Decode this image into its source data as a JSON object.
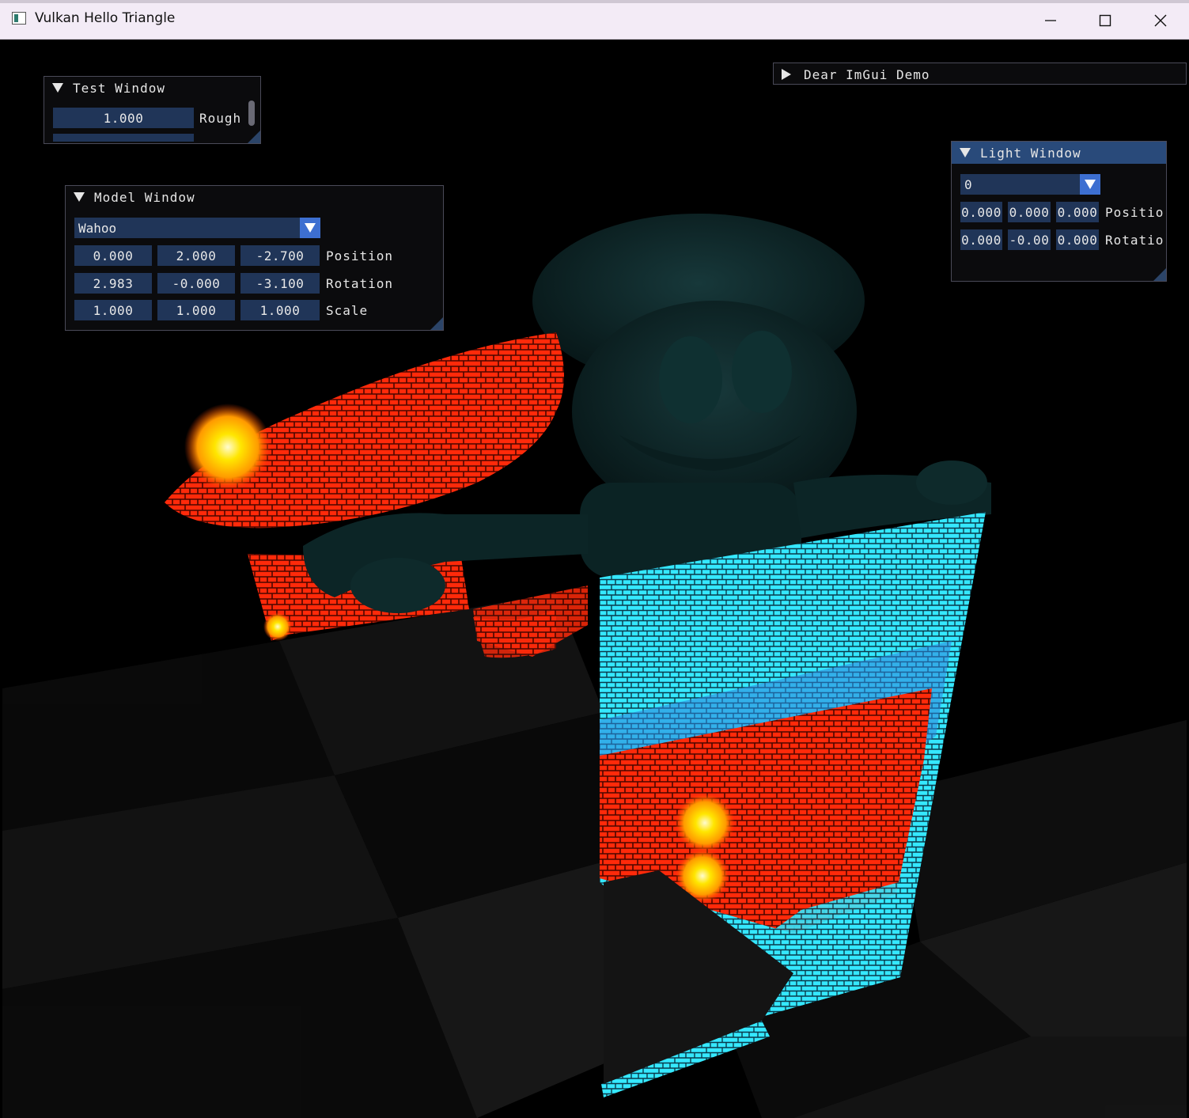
{
  "window": {
    "title": "Vulkan Hello Triangle",
    "controls": {
      "minimize": "─",
      "maximize": "☐",
      "close": "✕"
    }
  },
  "test_window": {
    "title": "Test Window",
    "rows": [
      {
        "value": "1.000",
        "label": "Rough"
      }
    ]
  },
  "demo_window": {
    "title": "Dear ImGui Demo"
  },
  "model_window": {
    "title": "Model Window",
    "selected_model": "Wahoo",
    "rows": [
      {
        "label": "Position",
        "values": [
          "0.000",
          "2.000",
          "-2.700"
        ]
      },
      {
        "label": "Rotation",
        "values": [
          "2.983",
          "-0.000",
          "-3.100"
        ]
      },
      {
        "label": "Scale",
        "values": [
          "1.000",
          "1.000",
          "1.000"
        ]
      }
    ]
  },
  "light_window": {
    "title": "Light Window",
    "selected_light": "0",
    "rows": [
      {
        "label": "Positio",
        "values": [
          "0.000",
          "0.000",
          "0.000"
        ]
      },
      {
        "label": "Rotatio",
        "values": [
          "0.000",
          "-0.00",
          "0.000"
        ]
      }
    ]
  },
  "colors": {
    "field_bg": "#203558",
    "header_active": "#294a7a",
    "combo_button": "#3d6fd1",
    "mosaic_red": "#ff2a0a",
    "mosaic_cyan": "#35f0ff",
    "character_teal": "#0d2a2c"
  }
}
